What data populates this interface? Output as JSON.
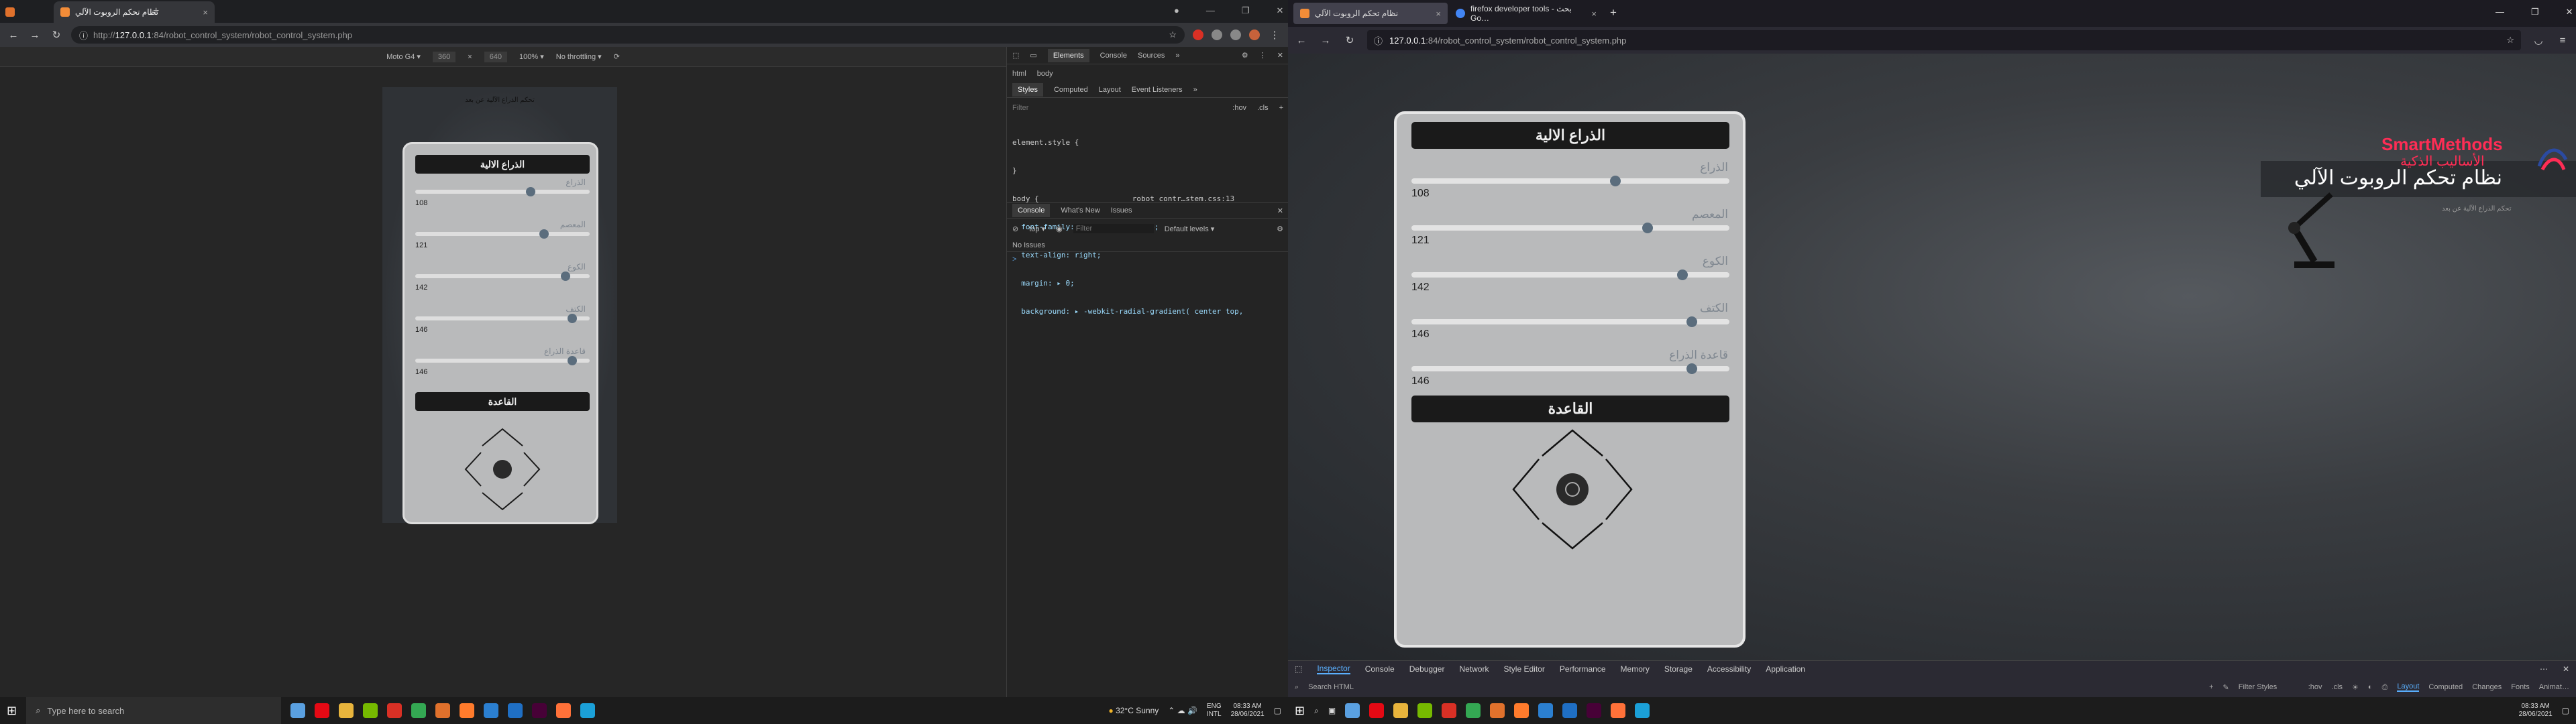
{
  "chrome": {
    "tabs": [
      {
        "title": "نظام تحكم الروبوت الآلي",
        "close": "×"
      },
      {
        "title": "",
        "close": ""
      }
    ],
    "new_tab": "+",
    "url_prefix": "http://",
    "url_host": "127.0.0.1",
    "url_path": ":84/robot_control_system/robot_control_system.php",
    "device": "Moto G4 ▾",
    "width": "360",
    "x": "×",
    "height": "640",
    "zoom": "100% ▾",
    "throttle": "No throttling ▾",
    "devtools": {
      "tabs": [
        "Elements",
        "Console",
        "Sources",
        "»"
      ],
      "active_tab": "Elements",
      "breadcrumb": [
        "html",
        "body"
      ],
      "panel_tabs": [
        "Styles",
        "Computed",
        "Layout",
        "Event Listeners",
        "»"
      ],
      "filter_placeholder": "Filter",
      "hov": ":hov",
      "cls": ".cls",
      "plus": "+",
      "css_lines": [
        "element.style {",
        "}",
        "body {                     robot_contr…stem.css:13",
        "  font-family: \"Tajawal\", Roboto;",
        "  text-align: right;",
        "  margin: ▸ 0;",
        "  background: ▸ -webkit-radial-gradient( center top,"
      ],
      "drawer_tabs": [
        "Console",
        "What's New",
        "Issues"
      ],
      "console_context": "top ▾",
      "console_filter": "Filter",
      "levels": "Default levels ▾",
      "issues": "No Issues",
      "prompt": ">"
    },
    "mobile": {
      "title": "تحكم الذراع الآلية عن بعد",
      "header": "الذراع الالية",
      "sliders": [
        {
          "label": "الذراع",
          "value": "108",
          "pos": 0.66
        },
        {
          "label": "المعصم",
          "value": "121",
          "pos": 0.74
        },
        {
          "label": "الكوع",
          "value": "142",
          "pos": 0.86
        },
        {
          "label": "الكتف",
          "value": "146",
          "pos": 0.9
        },
        {
          "label": "قاعدة الذراع",
          "value": "146",
          "pos": 0.9
        }
      ],
      "base_button": "القاعدة"
    }
  },
  "taskbar": {
    "search": "Type here to search",
    "weather": "32°C  Sunny",
    "lang": "ENG",
    "region": "INTL",
    "time": "08:33 AM",
    "date": "28/06/2021"
  },
  "firefox": {
    "tabs": [
      {
        "title": "نظام تحكم الروبوت الآلي",
        "close": "×"
      },
      {
        "title": "firefox developer tools - بحث Go…",
        "close": "×"
      }
    ],
    "new_tab": "+",
    "url_host": "127.0.0.1",
    "url_path": ":84/robot_control_system/robot_control_system.php",
    "panel": {
      "header": "الذراع الالية",
      "sliders": [
        {
          "label": "الذراع",
          "value": "108",
          "pos": 0.64
        },
        {
          "label": "المعصم",
          "value": "121",
          "pos": 0.74
        },
        {
          "label": "الكوع",
          "value": "142",
          "pos": 0.85
        },
        {
          "label": "الكتف",
          "value": "146",
          "pos": 0.88
        },
        {
          "label": "قاعدة الذراع",
          "value": "146",
          "pos": 0.88
        }
      ],
      "base_button": "القاعدة"
    },
    "banner": "نظام تحكم الروبوت الآلي",
    "sub": "تحكم الذراع الآلية عن بعد",
    "logo_en": "SmartMethods",
    "logo_ar": "الأساليب الذكية",
    "devtools": {
      "tabs": [
        "Inspector",
        "Console",
        "Debugger",
        "Network",
        "Style Editor",
        "Performance",
        "Memory",
        "Storage",
        "Accessibility",
        "Application"
      ],
      "active_tab": "Inspector",
      "search": "Search HTML",
      "filter_styles": "Filter Styles",
      "hov": ":hov",
      "cls": ".cls",
      "right_tabs": [
        "Layout",
        "Computed",
        "Changes",
        "Fonts",
        "Animat…"
      ],
      "right_active": "Layout"
    }
  },
  "colors": {
    "chrome_bg": "#202124",
    "panel": "#b9babb",
    "header": "#1a1a1a",
    "thumb": "#5b6d7d",
    "label": "#7f8790",
    "brand": "#ff2d55"
  }
}
